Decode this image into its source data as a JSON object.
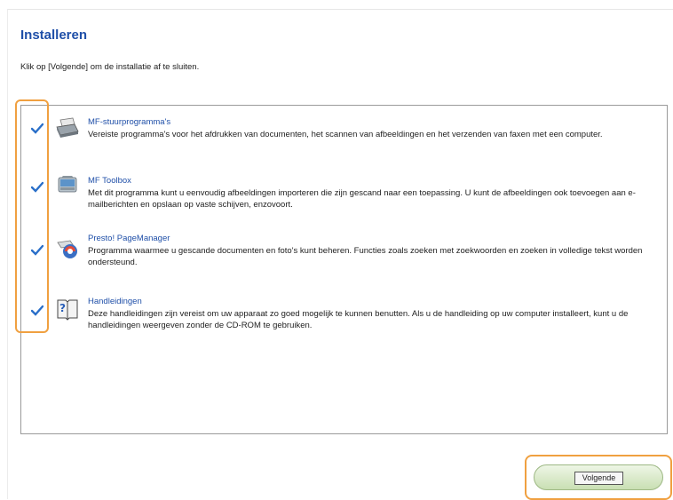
{
  "header": {
    "title": "Installeren",
    "instruction": "Klik op [Volgende] om de installatie af te sluiten."
  },
  "items": [
    {
      "title": "MF-stuurprogramma's",
      "description": "Vereiste programma's voor het afdrukken van documenten, het scannen van afbeeldingen en het verzenden van faxen met een computer.",
      "icon": "printer-icon",
      "checked": true
    },
    {
      "title": "MF Toolbox",
      "description": "Met dit programma kunt u eenvoudig afbeeldingen importeren die zijn gescand naar een toepassing. U kunt de afbeeldingen ook toevoegen aan e-mailberichten en opslaan op vaste schijven, enzovoort.",
      "icon": "toolbox-icon",
      "checked": true
    },
    {
      "title": "Presto! PageManager",
      "description": "Programma waarmee u gescande documenten en foto's kunt beheren. Functies zoals zoeken met zoekwoorden en zoeken in volledige tekst worden ondersteund.",
      "icon": "pagemanager-icon",
      "checked": true
    },
    {
      "title": "Handleidingen",
      "description": "Deze handleidingen zijn vereist om uw apparaat zo goed mogelijk te kunnen benutten. Als u de handleiding op uw computer installeert, kunt u de handleidingen weergeven zonder de CD-ROM te gebruiken.",
      "icon": "manual-icon",
      "checked": true
    }
  ],
  "footer": {
    "next_label": "Volgende"
  },
  "colors": {
    "title": "#1f4fa8",
    "highlight": "#f0a040",
    "check": "#2a6fc9",
    "button": "#c9dfb3"
  }
}
